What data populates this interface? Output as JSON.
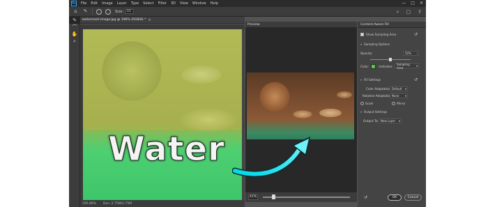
{
  "menubar": {
    "logo": "Ps",
    "items": [
      "File",
      "Edit",
      "Image",
      "Layer",
      "Type",
      "Select",
      "Filter",
      "3D",
      "View",
      "Window",
      "Help"
    ],
    "window_controls": [
      "—",
      "□",
      "✕"
    ]
  },
  "options": {
    "size_label": "Size:",
    "size_value": "15"
  },
  "document": {
    "tab_label": "watermark-image.jpg @ 196% (RGB/8) *",
    "close": "×",
    "watermark_text": "Water",
    "zoom": "195.86%",
    "doc_info": "Doc: 2.75M/2.75M"
  },
  "preview": {
    "tab_label": "Preview",
    "zoom": "41%",
    "zoom_level": 0.1
  },
  "panel": {
    "title": "Content-Aware Fill",
    "show_sampling_area": "Show Sampling Area",
    "sampling_options": "Sampling Options",
    "opacity_label": "Opacity:",
    "opacity_value": "50%",
    "opacity_level": 0.5,
    "color_label": "Color:",
    "indicates_label": "Indicates:",
    "indicates_value": "Sampling Area",
    "color": "#55c64a",
    "fill_settings": "Fill Settings",
    "color_adaptation_label": "Color Adaptation:",
    "color_adaptation_value": "Default",
    "rotation_adaptation_label": "Rotation Adaptation:",
    "rotation_adaptation_value": "None",
    "scale_label": "Scale",
    "mirror_label": "Mirror",
    "output_settings": "Output Settings",
    "output_to_label": "Output To:",
    "output_to_value": "New Layer",
    "ok_label": "OK",
    "cancel_label": "Cancel"
  }
}
